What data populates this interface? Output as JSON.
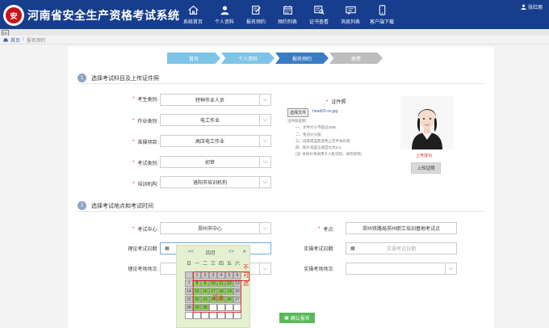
{
  "header": {
    "logo_text": "安",
    "title": "河南省安全生产资格考试系统",
    "nav": [
      {
        "label": "系统首页",
        "icon": "home-icon"
      },
      {
        "label": "个人资料",
        "icon": "person-icon"
      },
      {
        "label": "报名预约",
        "icon": "edit-form-icon"
      },
      {
        "label": "预约列表",
        "icon": "calendar-list-icon"
      },
      {
        "label": "证书查看",
        "icon": "certificate-search-icon"
      },
      {
        "label": "消息列表",
        "icon": "message-icon"
      },
      {
        "label": "客户端下载",
        "icon": "phone-download-icon"
      }
    ],
    "user_name": "张红丽",
    "colors": {
      "header_bg": "#163e8c"
    }
  },
  "breadcrumb": {
    "home": "首页",
    "separator": "/",
    "current": "报名预约"
  },
  "steps": [
    {
      "label": "首页",
      "state": "done"
    },
    {
      "label": "个人资料",
      "state": "done"
    },
    {
      "label": "报名预约",
      "state": "active"
    },
    {
      "label": "缴费",
      "state": "todo"
    }
  ],
  "section1": {
    "number": "1",
    "title": "选择考试科目及上传证件照",
    "fields": [
      {
        "label": "考生类别:",
        "value": "特种作业人员"
      },
      {
        "label": "作业类别:",
        "value": "电工作业"
      },
      {
        "label": "准操项目:",
        "value": "高压电工作业"
      },
      {
        "label": "考试类别:",
        "value": "初审"
      },
      {
        "label": "培训机构:",
        "value": "洛阳市培训机构"
      }
    ],
    "id_photo": {
      "title": "证件照",
      "choose_file": "选择文件",
      "file_name": "head02-nv.jpg",
      "notes": [
        "证件照说明：",
        "一、文件大小不超过2MB;",
        "二、免冠大头照;",
        "三、白底或蓝底深色上衣半身彩照;",
        "四、照片高度与宽度比为5:4。",
        "(注: 本照片将采用于人脸识别，请勿修饰)"
      ],
      "upload_status": "上传成功",
      "upload_button": "上传证照"
    }
  },
  "section2": {
    "number": "2",
    "title": "选择考试地点和考试时间",
    "exam_center_label": "考试中心:",
    "exam_center_value": "郑州市中心",
    "exam_site_label": "考点:",
    "exam_site_value": "郑州铁路局郑州职工培训基地考试点",
    "theory_date_label": "理论考试日期:",
    "theory_date_value": "",
    "practical_date_label": "实操考试日期:",
    "practical_date_placeholder": "实操考试日期",
    "theory_session_label": "理论考场场次:",
    "practical_session_label": "实操考场场次:",
    "partial_button": "步",
    "confirm_button": "确认报名"
  },
  "calendar": {
    "prev": "<<",
    "month": "四月",
    "next": ">>",
    "close": "×",
    "weekdays": [
      "日",
      "一",
      "二",
      "三",
      "四",
      "五",
      "六"
    ],
    "rows": [
      [
        "",
        "1",
        "2",
        "3",
        "4",
        "5",
        "6"
      ],
      [
        "7",
        "8",
        "9",
        "10",
        "11",
        "12",
        "13"
      ],
      [
        "14",
        "15",
        "16",
        "17",
        "18",
        "19",
        "20"
      ],
      [
        "21",
        "22",
        "23",
        "24",
        "25",
        "26",
        "27"
      ],
      [
        "28",
        "29",
        "30",
        "",
        "",
        "",
        ""
      ],
      [
        "",
        "",
        "",
        "",
        "",
        "",
        ""
      ]
    ],
    "annotation_unavailable": "不可选",
    "annotation_available": "可选"
  }
}
